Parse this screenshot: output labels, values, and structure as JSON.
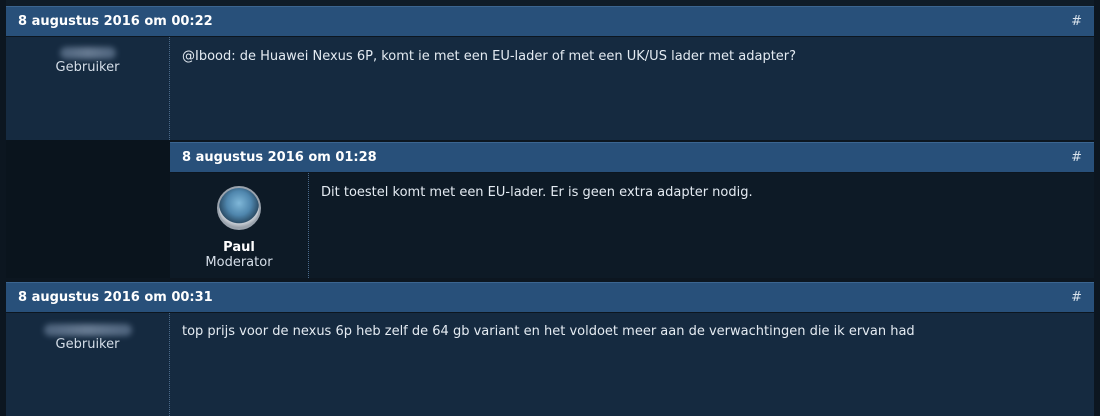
{
  "posts": [
    {
      "date": "8 augustus 2016 om 00:22",
      "permalink": "#",
      "author_role": "Gebruiker",
      "message": "@Ibood: de Huawei Nexus 6P, komt ie met een EU-lader of met een UK/US lader met adapter?"
    },
    {
      "date": "8 augustus 2016 om 01:28",
      "permalink": "#",
      "author_name": "Paul",
      "author_role": "Moderator",
      "message": "Dit toestel komt met een EU-lader. Er is geen extra adapter nodig."
    },
    {
      "date": "8 augustus 2016 om 00:31",
      "permalink": "#",
      "author_role": "Gebruiker",
      "message": "top prijs voor de nexus 6p heb zelf de 64 gb variant en het voldoet meer aan de verwachtingen die ik ervan had"
    }
  ]
}
